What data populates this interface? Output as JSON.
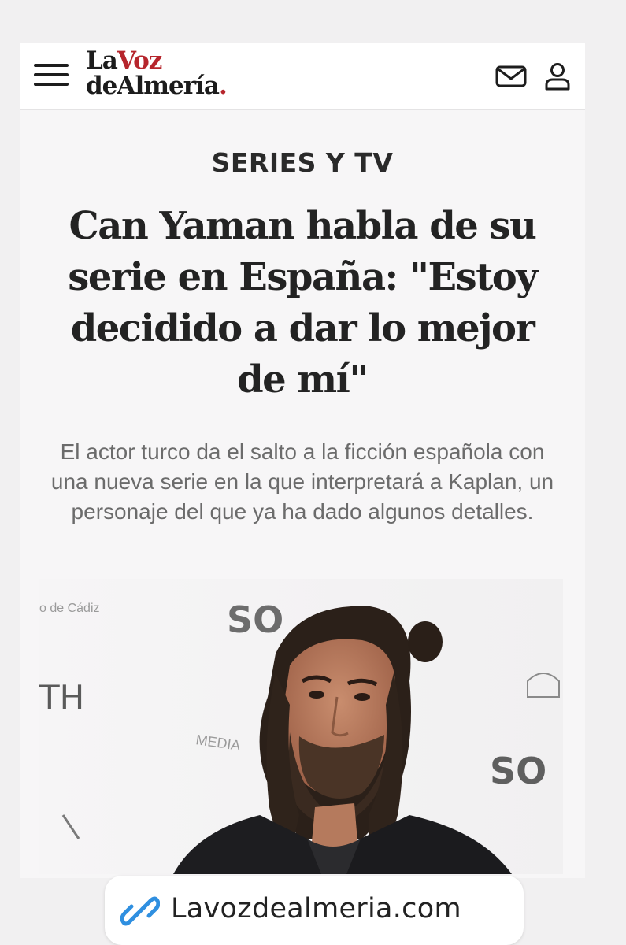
{
  "header": {
    "logo": {
      "line1_part1": "La",
      "line1_part2": "Voz",
      "line2": "deAlmería",
      "line2_dot": ".",
      "accent_color": "#b6252c"
    },
    "icons": {
      "menu": "hamburger-menu-icon",
      "mail": "mail-icon",
      "user": "user-icon"
    }
  },
  "article": {
    "section": "SERIES Y TV",
    "headline": "Can Yaman habla de su serie en España: \"Estoy decidido a dar lo mejor de mí\"",
    "subtitle": "El actor turco da el salto a la ficción española con una nueva serie en la que interpretará a Kaplan, un personaje del que ya ha dado algunos detalles.",
    "photo_backdrop_text": {
      "top_left": "o de Cádiz",
      "top": "SO",
      "left": "TH",
      "media": "MEDIA",
      "right": "SO"
    }
  },
  "link_sticker": {
    "icon": "link-icon",
    "icon_color": "#2f8fe0",
    "label": "Lavozdealmeria.com"
  }
}
